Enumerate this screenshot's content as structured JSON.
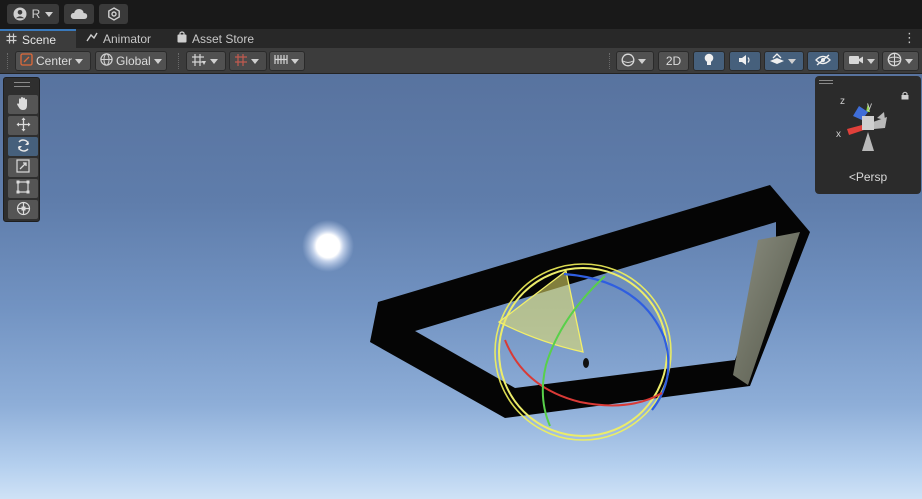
{
  "topbar": {
    "account_label": "R",
    "account_icon": "account-circle-icon",
    "cloud_icon": "cloud-icon",
    "settings_icon": "hexagon-settings-icon"
  },
  "tabs": [
    {
      "label": "Scene",
      "icon": "grid-icon",
      "active": true
    },
    {
      "label": "Animator",
      "icon": "animator-icon",
      "active": false
    },
    {
      "label": "Asset Store",
      "icon": "bag-icon",
      "active": false
    }
  ],
  "toolbar": {
    "pivot_mode": "Center",
    "pivot_space": "Global",
    "mode_2d": "2D"
  },
  "tools": [
    "hand-tool",
    "move-tool",
    "rotate-tool",
    "scale-tool",
    "rect-tool",
    "transform-tool"
  ],
  "active_tool": "rotate-tool",
  "gizmo": {
    "projection_label": "Persp",
    "axis_labels": {
      "y": "y",
      "x": "x",
      "z": "z"
    }
  },
  "colors": {
    "accent": "#3a79bb",
    "active_button": "#46607c",
    "axis_x": "#e0403a",
    "axis_y": "#8ed34a",
    "axis_z": "#3f6ed8",
    "rotate_ring_outer": "#f2f25a"
  }
}
